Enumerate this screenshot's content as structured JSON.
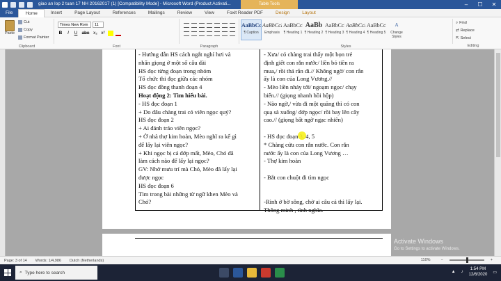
{
  "window": {
    "title": "giao an lop 2 tuan 17 NH 20162017 (1) [Compatibility Mode] - Microsoft Word (Product Activati...",
    "table_tools": "Table Tools",
    "controls": [
      "–",
      "☐",
      "✕"
    ]
  },
  "tabs": [
    "File",
    "Home",
    "Insert",
    "Page Layout",
    "References",
    "Mailings",
    "Review",
    "View",
    "Foxit Reader PDF",
    "Design",
    "Layout"
  ],
  "ribbon": {
    "clipboard": {
      "paste": "Paste",
      "cut": "Cut",
      "copy": "Copy",
      "format_painter": "Format Painter",
      "label": "Clipboard"
    },
    "font": {
      "name": "Times New Rom",
      "size": "11",
      "label": "Font",
      "buttons": [
        "B",
        "I",
        "U",
        "abe",
        "x₂",
        "x²"
      ]
    },
    "paragraph": {
      "label": "Paragraph"
    },
    "styles": {
      "label": "Styles",
      "items": [
        {
          "sample": "AaBbCc",
          "name": "¶ Caption"
        },
        {
          "sample": "AaBbCcI",
          "name": "Emphasis"
        },
        {
          "sample": "AaBbCcI",
          "name": "¶ Heading 1"
        },
        {
          "sample": "AaBb",
          "name": "¶ Heading 2"
        },
        {
          "sample": "AaBbCcI",
          "name": "¶ Heading 3"
        },
        {
          "sample": "AaBbCcI",
          "name": "¶ Heading 4"
        },
        {
          "sample": "AaBbCcI",
          "name": "¶ Heading 5"
        }
      ],
      "change_styles": "Change Styles"
    },
    "editing": {
      "find": "Find",
      "replace": "Replace",
      "select": "Select",
      "label": "Editing"
    }
  },
  "document": {
    "left_column": [
      {
        "text": "-  Hướng dẫn HS cách ngắt nghỉ hơi và",
        "bold": false
      },
      {
        "text": "nhấn giọng ở một số câu dài",
        "bold": false
      },
      {
        "text": "  HS đọc từng đoạn trong nhóm",
        "bold": false
      },
      {
        "text": " Tổ chức thi đọc giữa các nhóm",
        "bold": false
      },
      {
        "text": "  HS đọc đồng thanh đoạn 4",
        "bold": false
      },
      {
        "text": "Hoạt động 2: Tìm hiểu bài.",
        "bold": true
      },
      {
        "text": "  -   HS đọc đoạn 1",
        "bold": false
      },
      {
        "text": "      + Do đâu chàng trai có viên ngọc quý?",
        "bold": false
      },
      {
        "text": "      HS đọc đoạn 2",
        "bold": false
      },
      {
        "text": "        + Ai đánh tráo viên ngọc?",
        "bold": false
      },
      {
        "text": "+ Ở nhà thợ kim hoàn, Mèo nghĩ ra kế gì",
        "bold": false
      },
      {
        "text": "để lấy lại viên ngọc?",
        "bold": false
      },
      {
        "text": "+ Khi ngọc bị cá đớp mất, Mèo, Chó đã",
        "bold": false
      },
      {
        "text": "làm cách nào để lấy lại ngọc?",
        "bold": false
      },
      {
        "text": " GV: Nhờ mưu trí mà Chó, Mèo đã lấy lại",
        "bold": false
      },
      {
        "text": "được ngọc",
        "bold": false
      },
      {
        "text": "  HS đọc đoạn 6",
        "bold": false
      },
      {
        "text": " Tìm trong bài những từ ngữ khen Mèo và",
        "bold": false
      },
      {
        "text": "Chó?",
        "bold": false
      }
    ],
    "right_column": [
      {
        "text": "-   Xưa/ có chàng trai thấy một bọn trẻ",
        "highlight": false
      },
      {
        "text": "định giết con rắn nước/ liền bỏ tiền ra",
        "highlight": false
      },
      {
        "text": "mua,/ rồi thả rắn đi.// Không ngờ/ con rắn",
        "highlight": false
      },
      {
        "text": "ấy là con của Long Vương.//",
        "highlight": false
      },
      {
        "text": "-   Mèo liền nhảy tới/ ngoạm ngọc/ chạy",
        "highlight": false
      },
      {
        "text": "biến.// (giọng nhanh hồi hộp)",
        "highlight": false
      },
      {
        "text": "-   Nào ngờ,/ vừa đi một quãng thì có con",
        "highlight": false
      },
      {
        "text": "quạ sà xuống/ đớp ngọc/ rồi bay lên cây",
        "highlight": false
      },
      {
        "text": "cao.// (giọng bất ngờ ngạc nhiên)",
        "highlight": false
      },
      {
        "text": "",
        "highlight": false
      },
      {
        "text": "-   HS đọc đoạn 3, 4, 5",
        "highlight": false
      },
      {
        "text": "*  Chàng cứu con rắn nước. Con rắn",
        "highlight": false
      },
      {
        "text": "nước ấy là con của Long Vương …",
        "highlight": false
      },
      {
        "text": "-   Thợ kim hoàn",
        "highlight": false
      },
      {
        "text": "",
        "highlight": false
      },
      {
        "text": "-   Bắt con chuột đi tìm ngọc",
        "highlight": false
      },
      {
        "text": "",
        "highlight": false
      },
      {
        "text": "",
        "highlight": false
      },
      {
        "text": "-Rình ở bờ sông, chờ ai câu cá thì lấy lại.",
        "highlight": false
      },
      {
        "text": " Thông minh , tình nghĩa.",
        "highlight": false
      }
    ]
  },
  "status": {
    "page": "Page: 3 of 14",
    "words": "Words: 1/4,986",
    "language": "Dutch (Netherlands)",
    "zoom": "110%"
  },
  "watermark": {
    "title": "Activate Windows",
    "subtitle": "Go to Settings to activate Windows."
  },
  "taskbar": {
    "search_placeholder": "Type here to search",
    "time": "1:54 PM",
    "date": "12/6/2020"
  }
}
